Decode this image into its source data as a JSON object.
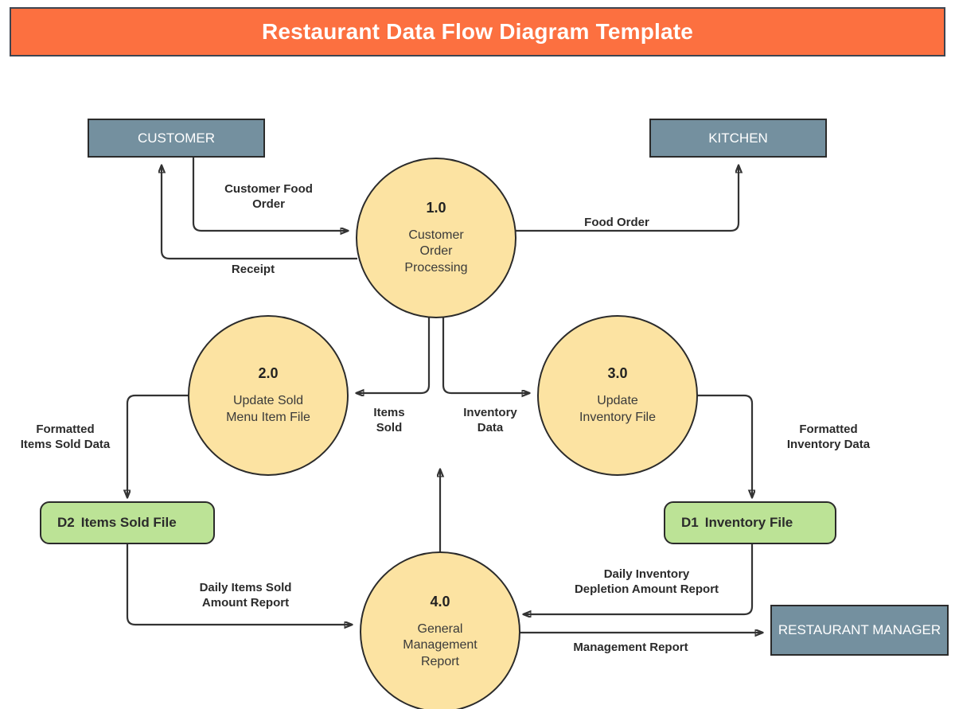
{
  "title": {
    "text": "Restaurant Data Flow Diagram Template",
    "banner_color": "#fc7040",
    "text_color": "#ffffff"
  },
  "palette": {
    "entity_fill": "#74909f",
    "process_fill": "#fce3a2",
    "datastore_fill": "#bce396",
    "stroke": "#2b2b2b",
    "label_text": "#2b2b2b"
  },
  "entities": [
    {
      "id": "customer",
      "label": "CUSTOMER"
    },
    {
      "id": "kitchen",
      "label": "KITCHEN"
    },
    {
      "id": "restaurant-manager",
      "label": "RESTAURANT\nMANAGER"
    }
  ],
  "processes": [
    {
      "id": "p1",
      "number": "1.0",
      "label": "Customer\nOrder\nProcessing"
    },
    {
      "id": "p2",
      "number": "2.0",
      "label": "Update Sold\nMenu Item File"
    },
    {
      "id": "p3",
      "number": "3.0",
      "label": "Update\nInventory File"
    },
    {
      "id": "p4",
      "number": "4.0",
      "label": "General\nManagement\nReport"
    }
  ],
  "datastores": [
    {
      "id": "d2",
      "code": "D2",
      "name": "Items Sold File"
    },
    {
      "id": "d1",
      "code": "D1",
      "name": "Inventory File"
    }
  ],
  "flows": [
    {
      "id": "customer-food-order",
      "label": "Customer Food\nOrder",
      "from": "customer",
      "to": "p1"
    },
    {
      "id": "receipt",
      "label": "Receipt",
      "from": "p1",
      "to": "customer"
    },
    {
      "id": "food-order",
      "label": "Food Order",
      "from": "p1",
      "to": "kitchen"
    },
    {
      "id": "items-sold",
      "label": "Items\nSold",
      "from": "p1",
      "to": "p2"
    },
    {
      "id": "inventory-data",
      "label": "Inventory\nData",
      "from": "p1",
      "to": "p3"
    },
    {
      "id": "formatted-items-sold-data",
      "label": "Formatted\nItems Sold Data",
      "from": "p2",
      "to": "d2"
    },
    {
      "id": "formatted-inventory-data",
      "label": "Formatted\nInventory Data",
      "from": "p3",
      "to": "d1"
    },
    {
      "id": "daily-items-sold-amount-report",
      "label": "Daily Items Sold\nAmount Report",
      "from": "d2",
      "to": "p4"
    },
    {
      "id": "daily-inventory-depletion-amount-report",
      "label": "Daily Inventory\nDepletion Amount Report",
      "from": "d1",
      "to": "p4"
    },
    {
      "id": "management-report",
      "label": "Management Report",
      "from": "p4",
      "to": "restaurant-manager"
    }
  ],
  "chart_data": {
    "type": "diagram",
    "diagram_kind": "data-flow-diagram",
    "title": "Restaurant Data Flow Diagram Template",
    "nodes": [
      {
        "id": "customer",
        "kind": "external-entity",
        "label": "CUSTOMER"
      },
      {
        "id": "kitchen",
        "kind": "external-entity",
        "label": "KITCHEN"
      },
      {
        "id": "restaurant-manager",
        "kind": "external-entity",
        "label": "RESTAURANT MANAGER"
      },
      {
        "id": "p1",
        "kind": "process",
        "number": "1.0",
        "label": "Customer Order Processing"
      },
      {
        "id": "p2",
        "kind": "process",
        "number": "2.0",
        "label": "Update Sold Menu Item File"
      },
      {
        "id": "p3",
        "kind": "process",
        "number": "3.0",
        "label": "Update Inventory File"
      },
      {
        "id": "p4",
        "kind": "process",
        "number": "4.0",
        "label": "General Management Report"
      },
      {
        "id": "d2",
        "kind": "data-store",
        "code": "D2",
        "label": "Items Sold File"
      },
      {
        "id": "d1",
        "kind": "data-store",
        "code": "D1",
        "label": "Inventory File"
      }
    ],
    "edges": [
      {
        "from": "customer",
        "to": "p1",
        "label": "Customer Food Order"
      },
      {
        "from": "p1",
        "to": "customer",
        "label": "Receipt"
      },
      {
        "from": "p1",
        "to": "kitchen",
        "label": "Food Order"
      },
      {
        "from": "p1",
        "to": "p2",
        "label": "Items Sold"
      },
      {
        "from": "p1",
        "to": "p3",
        "label": "Inventory Data"
      },
      {
        "from": "p2",
        "to": "d2",
        "label": "Formatted Items Sold Data"
      },
      {
        "from": "p3",
        "to": "d1",
        "label": "Formatted Inventory Data"
      },
      {
        "from": "d2",
        "to": "p4",
        "label": "Daily Items Sold Amount Report"
      },
      {
        "from": "d1",
        "to": "p4",
        "label": "Daily Inventory Depletion Amount Report"
      },
      {
        "from": "p4",
        "to": "restaurant-manager",
        "label": "Management Report"
      }
    ]
  }
}
